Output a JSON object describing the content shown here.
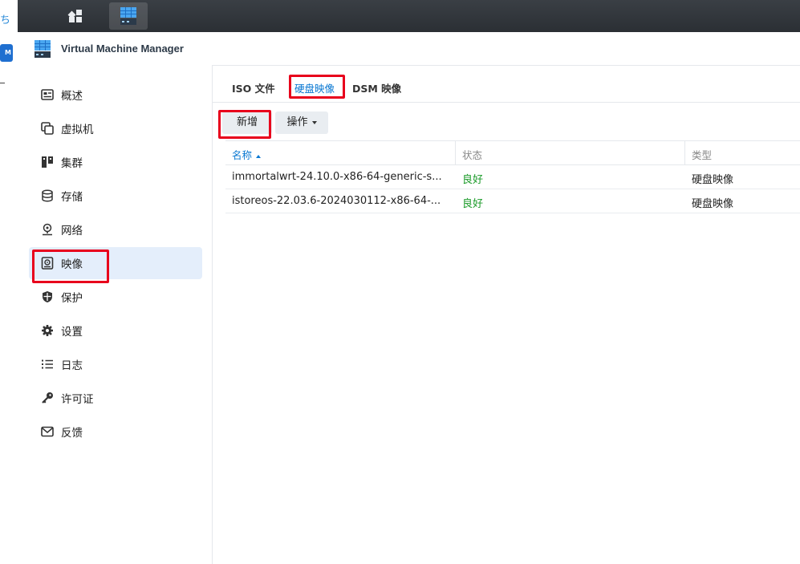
{
  "app": {
    "title": "Virtual Machine Manager"
  },
  "desktop": {
    "glyph": "ち",
    "app_badge": "M"
  },
  "taskbar": {
    "buttons": [
      {
        "name": "main-menu-icon",
        "active": false
      },
      {
        "name": "vmm-app-icon",
        "active": true
      }
    ]
  },
  "sidebar": {
    "items": [
      {
        "label": "概述",
        "icon": "overview-icon"
      },
      {
        "label": "虚拟机",
        "icon": "virtual-machine-icon"
      },
      {
        "label": "集群",
        "icon": "cluster-icon"
      },
      {
        "label": "存储",
        "icon": "storage-icon"
      },
      {
        "label": "网络",
        "icon": "network-icon"
      },
      {
        "label": "映像",
        "icon": "image-icon",
        "active": true
      },
      {
        "label": "保护",
        "icon": "shield-icon"
      },
      {
        "label": "设置",
        "icon": "gear-icon"
      },
      {
        "label": "日志",
        "icon": "log-list-icon"
      },
      {
        "label": "许可证",
        "icon": "key-icon"
      },
      {
        "label": "反馈",
        "icon": "mail-icon"
      }
    ]
  },
  "tabs": [
    {
      "label": "ISO 文件",
      "active": false
    },
    {
      "label": "硬盘映像",
      "active": true
    },
    {
      "label": "DSM 映像",
      "active": false
    }
  ],
  "toolbar": {
    "add_label": "新增",
    "action_label": "操作"
  },
  "table": {
    "columns": [
      "名称",
      "状态",
      "类型"
    ],
    "sort": "ascending",
    "rows": [
      {
        "name": "immortalwrt-24.10.0-x86-64-generic-s...",
        "status": "良好",
        "type": "硬盘映像"
      },
      {
        "name": "istoreos-22.03.6-2024030112-x86-64-...",
        "status": "良好",
        "type": "硬盘映像"
      }
    ]
  },
  "colors": {
    "accent": "#0a78d2",
    "ok": "#1a9a28",
    "highlight": "#e8001c",
    "taskbar": "#2b2f34"
  }
}
